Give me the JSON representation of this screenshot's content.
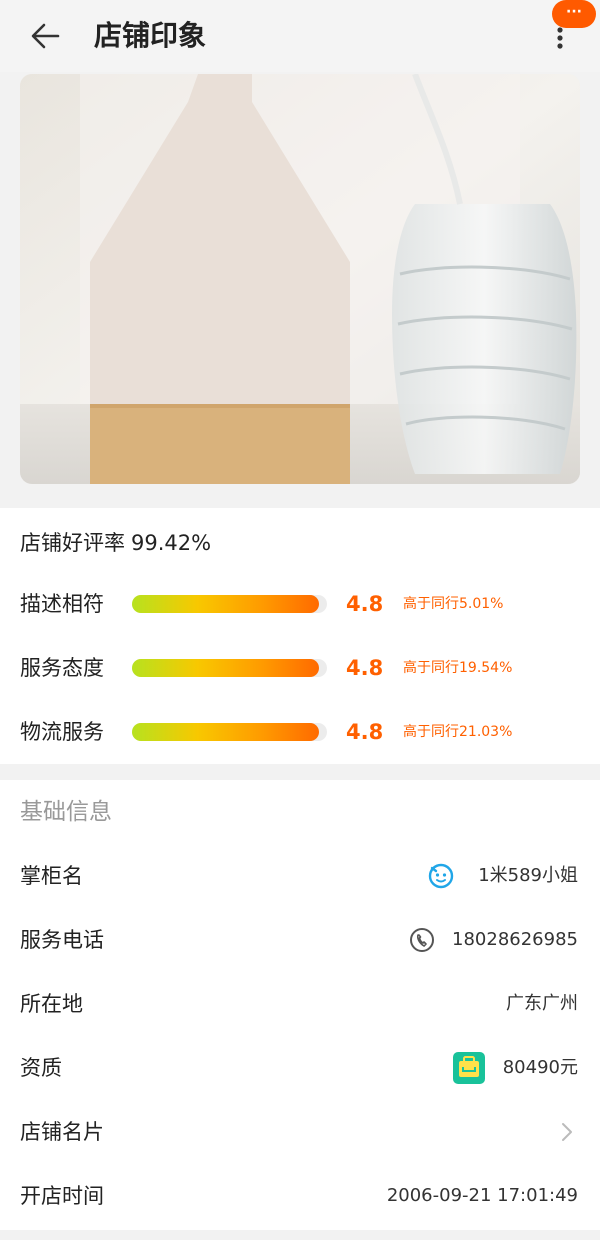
{
  "header": {
    "title": "店铺印象",
    "back_icon": "arrow-left-icon",
    "more_icon": "more-vertical-icon",
    "badge_text": "···"
  },
  "banner": {
    "image": "product-photo-vase-and-glass-bottle"
  },
  "ratings": {
    "good_rate_label": "店铺好评率",
    "good_rate_value": "99.42%",
    "items": [
      {
        "label": "描述相符",
        "score": "4.8",
        "fill_fraction": 0.96,
        "compare": "高于同行5.01%"
      },
      {
        "label": "服务态度",
        "score": "4.8",
        "fill_fraction": 0.96,
        "compare": "高于同行19.54%"
      },
      {
        "label": "物流服务",
        "score": "4.8",
        "fill_fraction": 0.96,
        "compare": "高于同行21.03%"
      }
    ],
    "accent_color": "#ff6000"
  },
  "info": {
    "section_title": "基础信息",
    "rows": [
      {
        "label": "掌柜名",
        "value": "1米589小姐",
        "icon": "wangwang-chat-icon"
      },
      {
        "label": "服务电话",
        "value": "18028626985",
        "icon": "phone-icon"
      },
      {
        "label": "所在地",
        "value": "广东广州"
      },
      {
        "label": "资质",
        "value": "80490元",
        "icon": "deposit-badge-icon"
      },
      {
        "label": "店铺名片",
        "value": "",
        "icon": "chevron-right-icon"
      },
      {
        "label": "开店时间",
        "value": "2006-09-21 17:01:49"
      }
    ]
  }
}
